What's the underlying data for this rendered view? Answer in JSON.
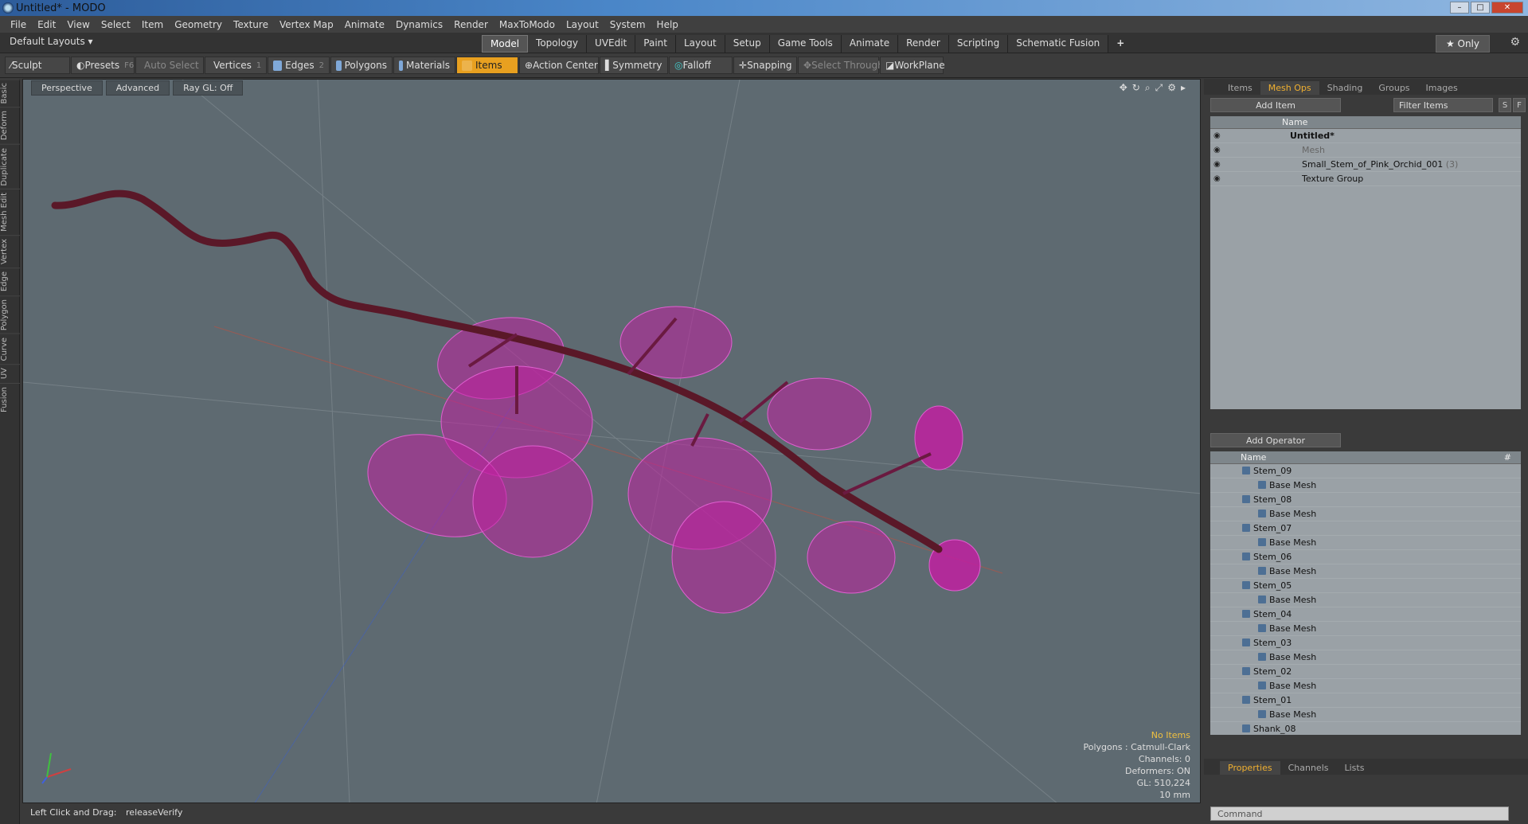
{
  "window": {
    "title": "Untitled* - MODO"
  },
  "menu": [
    "File",
    "Edit",
    "View",
    "Select",
    "Item",
    "Geometry",
    "Texture",
    "Vertex Map",
    "Animate",
    "Dynamics",
    "Render",
    "MaxToModo",
    "Layout",
    "System",
    "Help"
  ],
  "layouts_label": "Default Layouts ▾",
  "mode_tabs": [
    "Model",
    "Topology",
    "UVEdit",
    "Paint",
    "Layout",
    "Setup",
    "Game Tools",
    "Animate",
    "Render",
    "Scripting",
    "Schematic Fusion"
  ],
  "active_tab": "Model",
  "only_label": "★ Only",
  "toolbar": {
    "sculpt": "Sculpt",
    "presets": "Presets",
    "presets_key": "F6",
    "auto_select": "Auto Select",
    "vertices": "Vertices",
    "vertices_key": "1",
    "edges": "Edges",
    "edges_key": "2",
    "polygons": "Polygons",
    "materials": "Materials",
    "items": "Items",
    "action_center": "Action Center",
    "symmetry": "Symmetry",
    "falloff": "Falloff",
    "snapping": "Snapping",
    "select_through": "Select Through",
    "workplane": "WorkPlane"
  },
  "left_tabs": [
    "Basic",
    "Deform",
    "Duplicate",
    "Mesh Edit",
    "Vertex",
    "Edge",
    "Polygon",
    "Curve",
    "UV",
    "Fusion"
  ],
  "viewport": {
    "perspective": "Perspective",
    "advanced": "Advanced",
    "raygl": "Ray GL: Off",
    "info": {
      "no_items": "No Items",
      "polygons": "Polygons : Catmull-Clark",
      "channels": "Channels: 0",
      "deformers": "Deformers: ON",
      "gl": "GL: 510,224",
      "scale": "10 mm"
    }
  },
  "status": {
    "left": "Left Click and Drag:",
    "right": "releaseVerify"
  },
  "items_panel": {
    "tabs": [
      "Items",
      "Mesh Ops",
      "Shading",
      "Groups",
      "Images"
    ],
    "active": "Mesh Ops",
    "add_item": "Add Item",
    "filter": "Filter Items",
    "col_name": "Name",
    "rows": [
      {
        "label": "Untitled*",
        "indent": 0
      },
      {
        "label": "Mesh",
        "indent": 1
      },
      {
        "label": "Small_Stem_of_Pink_Orchid_001",
        "count": "(3)",
        "indent": 1
      },
      {
        "label": "Texture Group",
        "indent": 1
      }
    ]
  },
  "ops_panel": {
    "add_operator": "Add Operator",
    "col_name": "Name",
    "col_hash": "#",
    "rows": [
      "Stem_09",
      "Base Mesh",
      "Stem_08",
      "Base Mesh",
      "Stem_07",
      "Base Mesh",
      "Stem_06",
      "Base Mesh",
      "Stem_05",
      "Base Mesh",
      "Stem_04",
      "Base Mesh",
      "Stem_03",
      "Base Mesh",
      "Stem_02",
      "Base Mesh",
      "Stem_01",
      "Base Mesh",
      "Shank_08"
    ]
  },
  "props_panel": {
    "tabs": [
      "Properties",
      "Channels",
      "Lists"
    ],
    "active": "Properties"
  },
  "command_placeholder": "Command",
  "colors": {
    "accent": "#e8a020",
    "viewport_bg": "#5e6a71",
    "orchid": "#b01a90"
  }
}
